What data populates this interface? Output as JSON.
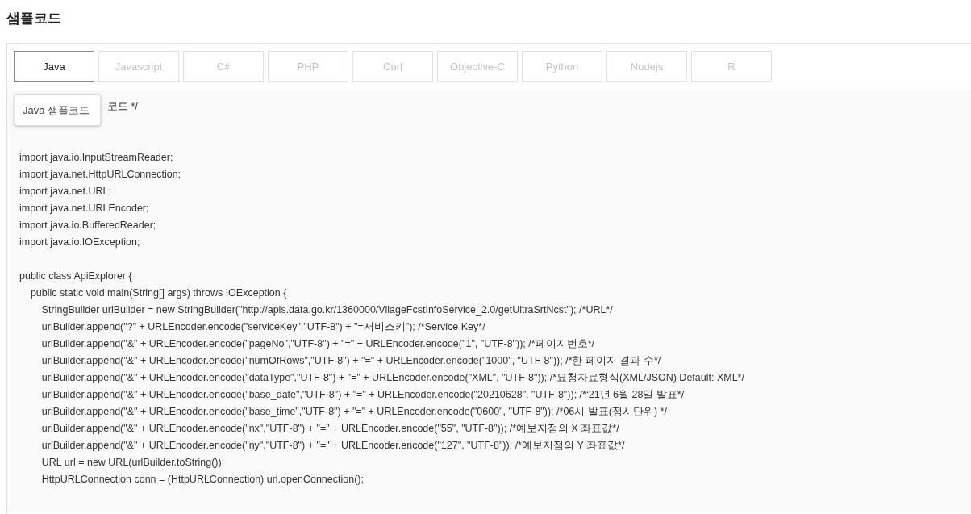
{
  "title": "샘플코드",
  "tabs": [
    {
      "label": "Java",
      "selected": true
    },
    {
      "label": "Javascript",
      "selected": false
    },
    {
      "label": "C#",
      "selected": false
    },
    {
      "label": "PHP",
      "selected": false
    },
    {
      "label": "Curl",
      "selected": false
    },
    {
      "label": "Objective-C",
      "selected": false
    },
    {
      "label": "Python",
      "selected": false
    },
    {
      "label": "Nodejs",
      "selected": false
    },
    {
      "label": "R",
      "selected": false
    }
  ],
  "tooltip": {
    "text": "Java 샘플코드"
  },
  "code_blocks": [
    [
      "코드 */"
    ],
    [
      "import java.io.InputStreamReader;",
      "import java.net.HttpURLConnection;",
      "import java.net.URL;",
      "import java.net.URLEncoder;",
      "import java.io.BufferedReader;",
      "import java.io.IOException;"
    ],
    [
      "public class ApiExplorer {",
      "    public static void main(String[] args) throws IOException {",
      "        StringBuilder urlBuilder = new StringBuilder(\"http://apis.data.go.kr/1360000/VilageFcstInfoService_2.0/getUltraSrtNcst\"); /*URL*/",
      "        urlBuilder.append(\"?\" + URLEncoder.encode(\"serviceKey\",\"UTF-8\") + \"=서비스키\"); /*Service Key*/",
      "        urlBuilder.append(\"&\" + URLEncoder.encode(\"pageNo\",\"UTF-8\") + \"=\" + URLEncoder.encode(\"1\", \"UTF-8\")); /*페이지번호*/",
      "        urlBuilder.append(\"&\" + URLEncoder.encode(\"numOfRows\",\"UTF-8\") + \"=\" + URLEncoder.encode(\"1000\", \"UTF-8\")); /*한 페이지 결과 수*/",
      "        urlBuilder.append(\"&\" + URLEncoder.encode(\"dataType\",\"UTF-8\") + \"=\" + URLEncoder.encode(\"XML\", \"UTF-8\")); /*요청자료형식(XML/JSON) Default: XML*/",
      "        urlBuilder.append(\"&\" + URLEncoder.encode(\"base_date\",\"UTF-8\") + \"=\" + URLEncoder.encode(\"20210628\", \"UTF-8\")); /*‘21년 6월 28일 발표*/",
      "        urlBuilder.append(\"&\" + URLEncoder.encode(\"base_time\",\"UTF-8\") + \"=\" + URLEncoder.encode(\"0600\", \"UTF-8\")); /*06시 발표(정시단위) */",
      "        urlBuilder.append(\"&\" + URLEncoder.encode(\"nx\",\"UTF-8\") + \"=\" + URLEncoder.encode(\"55\", \"UTF-8\")); /*예보지점의 X 좌표값*/",
      "        urlBuilder.append(\"&\" + URLEncoder.encode(\"ny\",\"UTF-8\") + \"=\" + URLEncoder.encode(\"127\", \"UTF-8\")); /*예보지점의 Y 좌표값*/",
      "        URL url = new URL(urlBuilder.toString());",
      "        HttpURLConnection conn = (HttpURLConnection) url.openConnection();"
    ]
  ]
}
